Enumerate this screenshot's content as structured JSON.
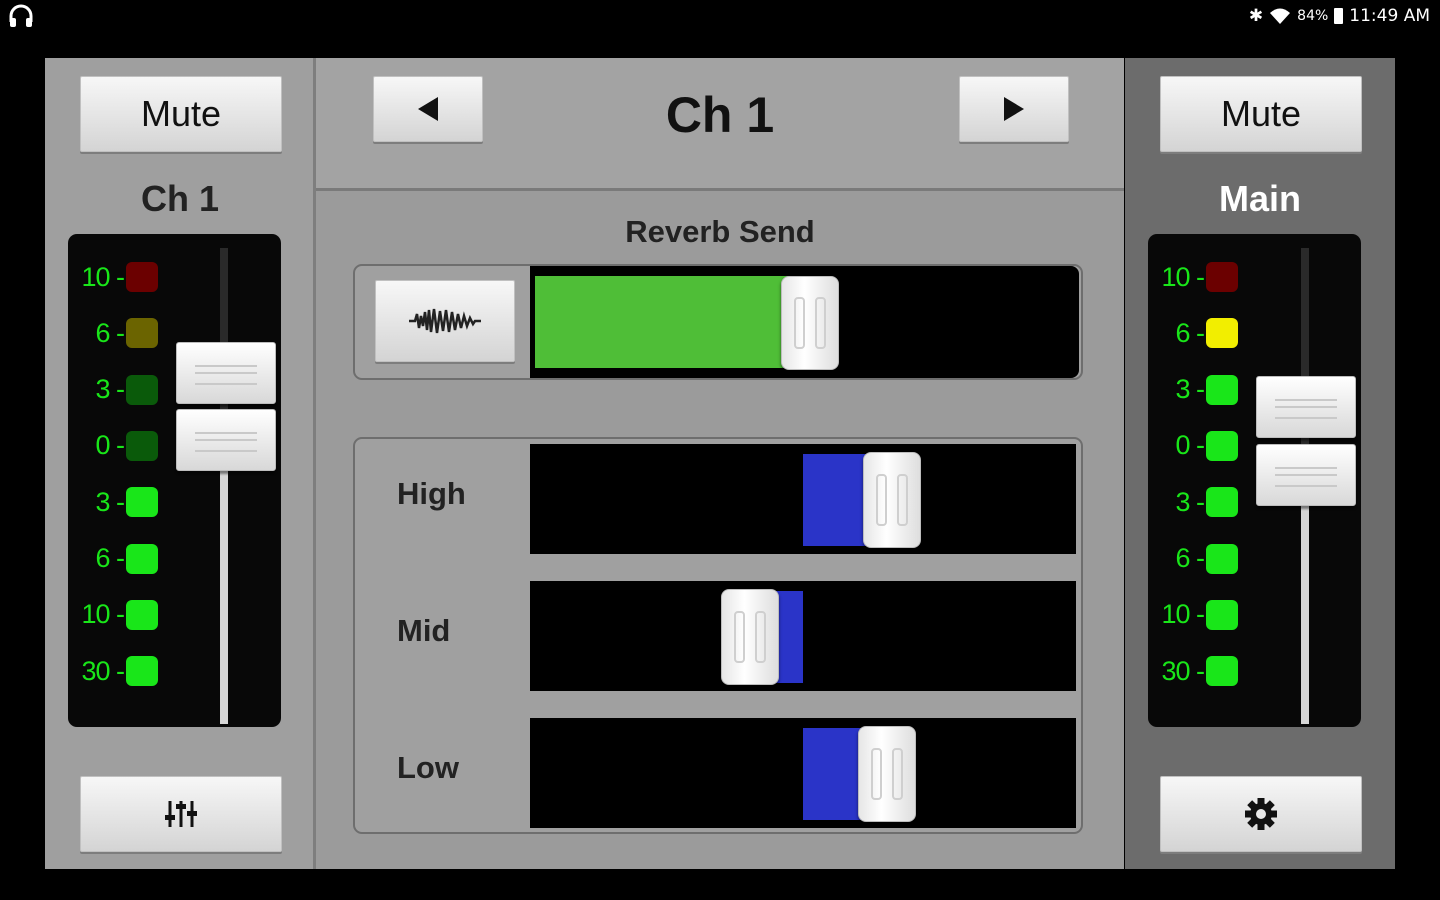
{
  "status_bar": {
    "left_icon": "headphones-icon",
    "icons": [
      "bluetooth-icon",
      "wifi-icon"
    ],
    "battery_text": "84%",
    "time": "11:49 AM"
  },
  "left_strip": {
    "mute_label": "Mute",
    "channel_label": "Ch 1",
    "meter_labels": [
      "10",
      "6",
      "3",
      "0",
      "3",
      "6",
      "10",
      "30"
    ],
    "led_colors": [
      "#6b0000",
      "#6b6400",
      "#0a5a0a",
      "#0a5a0a",
      "#19e619",
      "#19e619",
      "#19e619",
      "#19e619"
    ],
    "bottom_button_icon": "mixer-sliders-icon"
  },
  "center": {
    "title": "Ch 1",
    "prev_icon": "triangle-left-icon",
    "next_icon": "triangle-right-icon",
    "reverb": {
      "label": "Reverb Send",
      "icon": "waveform-icon",
      "value_percent": 51,
      "fill_color": "#4fbe37"
    },
    "eq": [
      {
        "label": "High",
        "value_percent": 68
      },
      {
        "label": "Mid",
        "value_percent": 39
      },
      {
        "label": "Low",
        "value_percent": 67
      }
    ],
    "eq_fill_color": "#2a34c8"
  },
  "right_strip": {
    "mute_label": "Mute",
    "channel_label": "Main",
    "meter_labels": [
      "10",
      "6",
      "3",
      "0",
      "3",
      "6",
      "10",
      "30"
    ],
    "led_colors": [
      "#6b0000",
      "#f2ee00",
      "#19e619",
      "#19e619",
      "#19e619",
      "#19e619",
      "#19e619",
      "#19e619"
    ],
    "bottom_button_icon": "gear-icon"
  }
}
